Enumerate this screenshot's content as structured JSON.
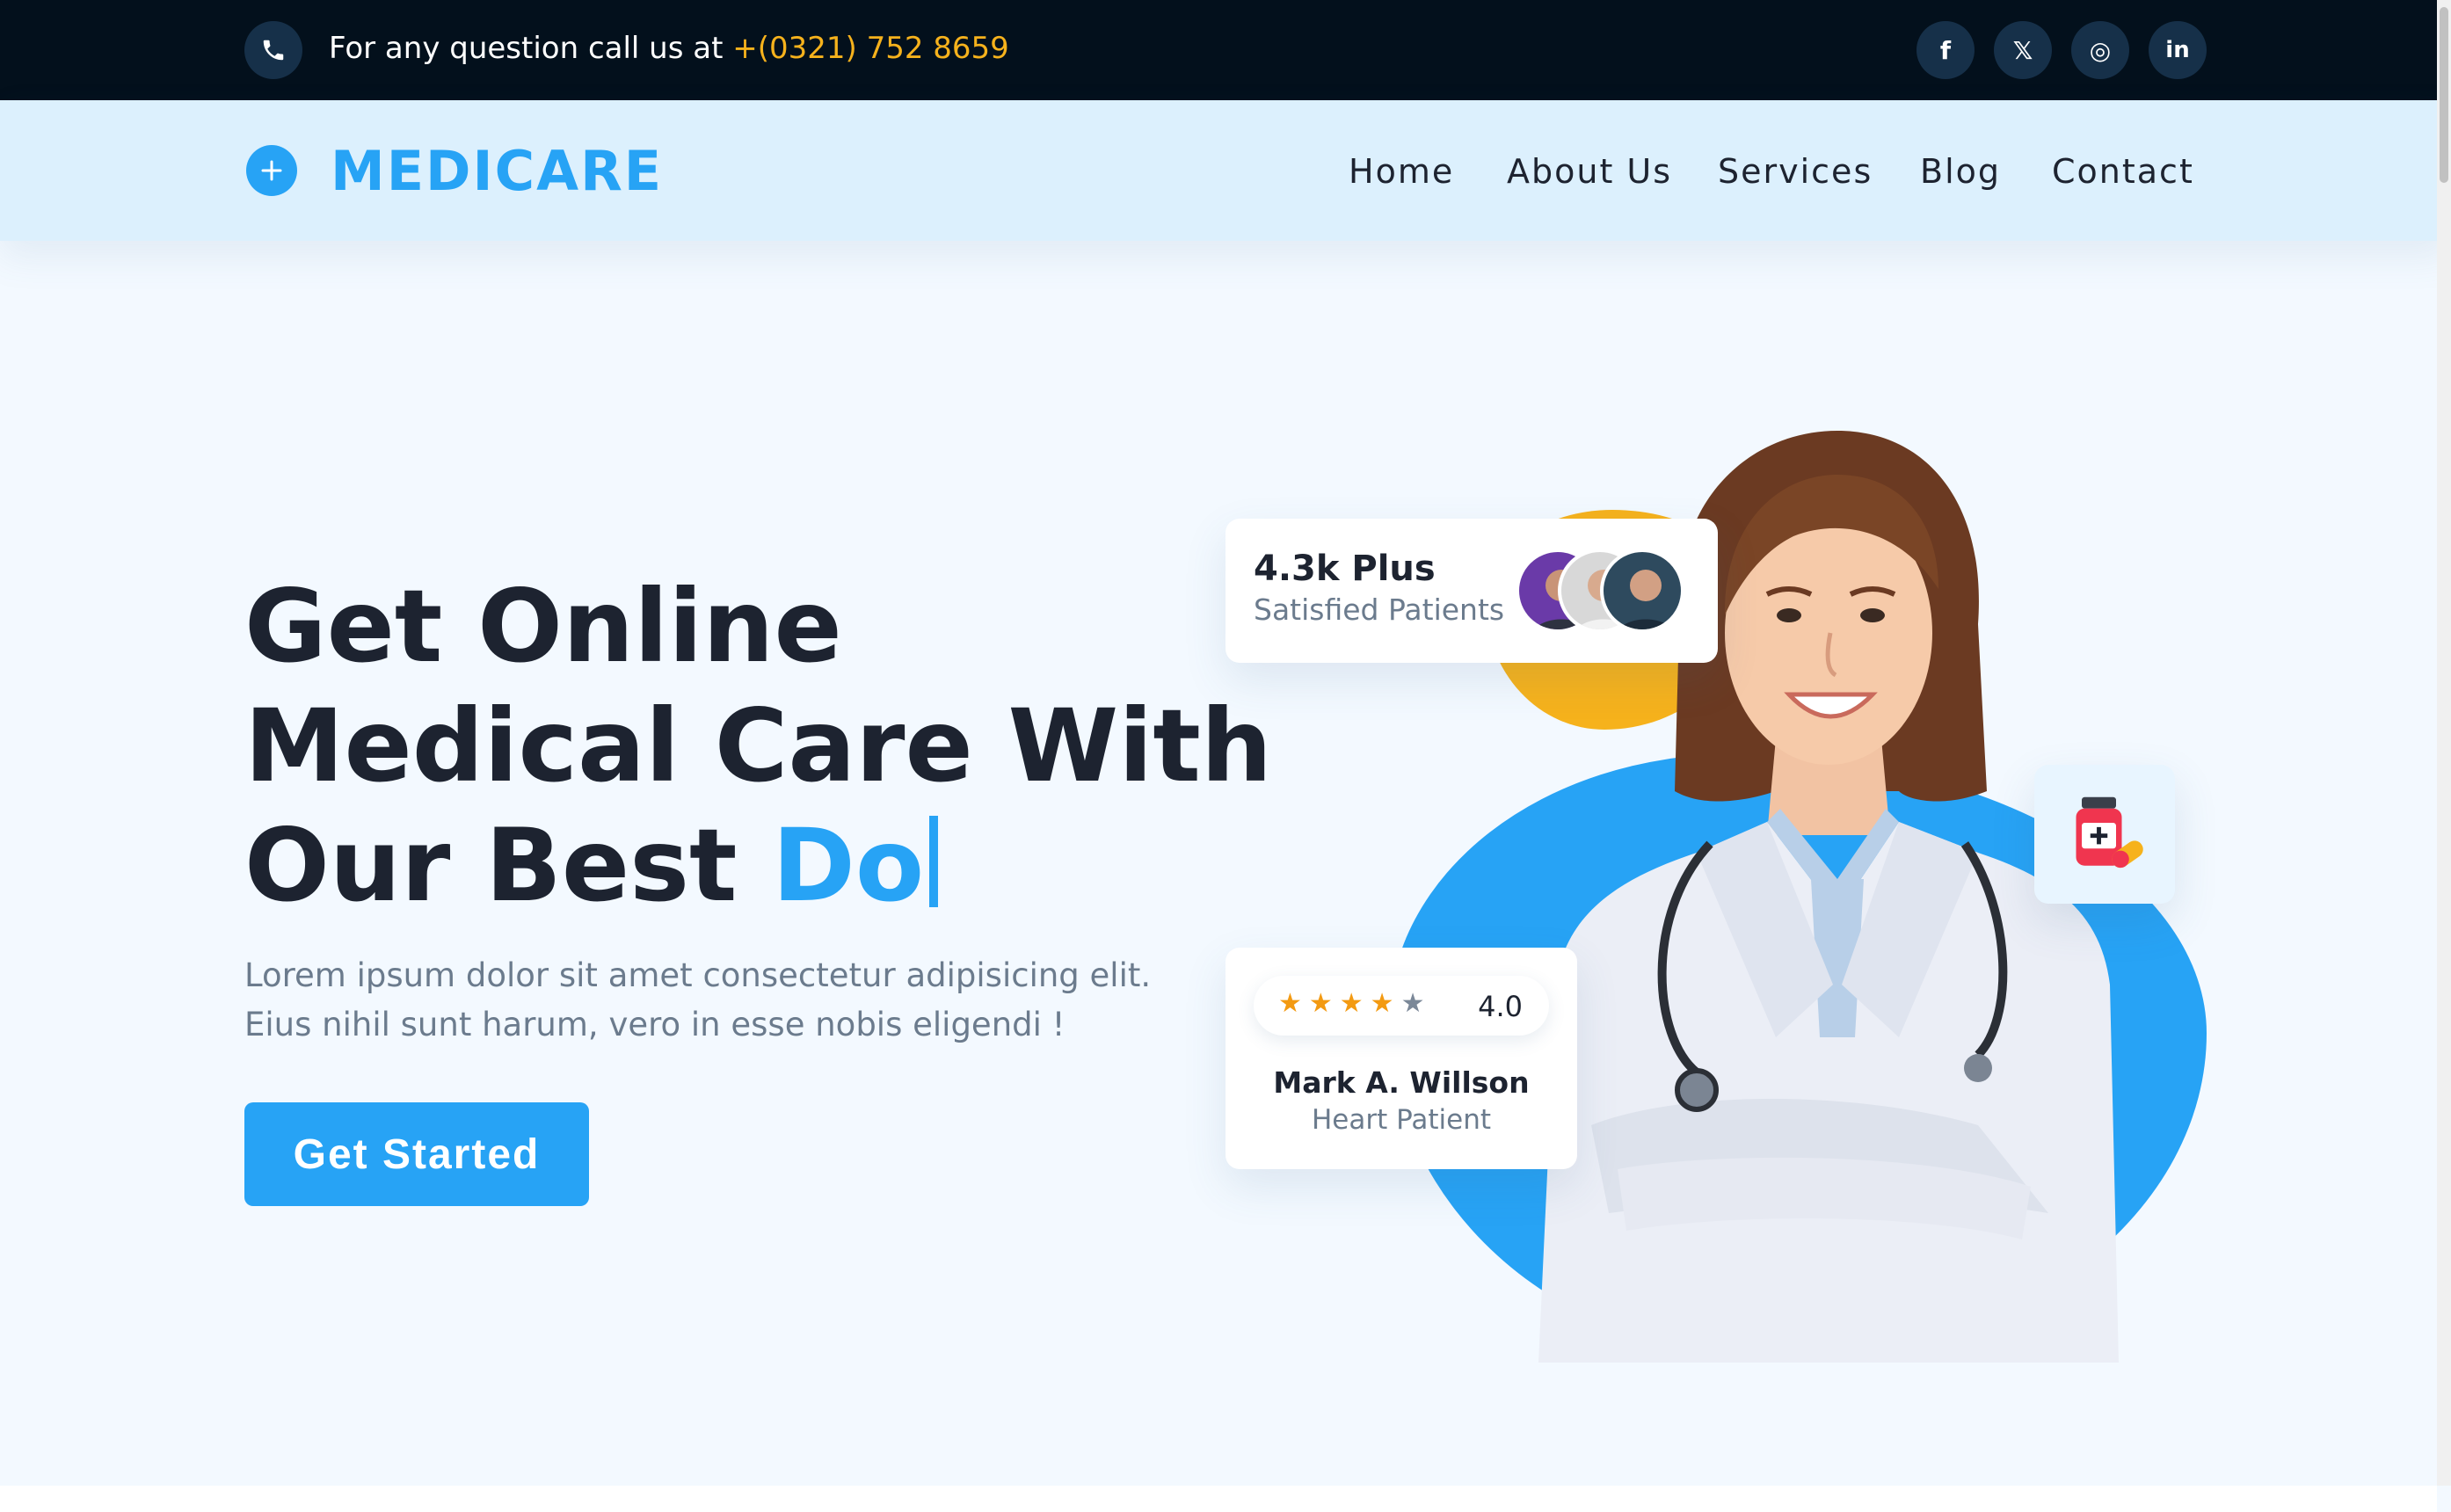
{
  "topbar": {
    "call_prefix": "For any question call us at ",
    "phone_number": "+(0321) 752 8659",
    "social": [
      {
        "icon": "facebook-icon",
        "glyph": "f"
      },
      {
        "icon": "x-icon",
        "glyph": "𝕏"
      },
      {
        "icon": "instagram-icon",
        "glyph": "◎"
      },
      {
        "icon": "linkedin-icon",
        "glyph": "in"
      }
    ]
  },
  "brand": {
    "name": "MEDICARE",
    "accent_color": "#27a3f5"
  },
  "nav": {
    "items": [
      "Home",
      "About Us",
      "Services",
      "Blog",
      "Contact"
    ]
  },
  "hero": {
    "title_line1": "Get Online",
    "title_line2": "Medical Care With",
    "title_line3": "Our Best ",
    "title_typed": "Do",
    "description": "Lorem ipsum dolor sit amet consectetur adipisicing elit. Eius nihil sunt harum, vero in esse nobis eligendi !",
    "cta_label": "Get Started"
  },
  "patients_card": {
    "count": "4.3k Plus",
    "label": "Satisfied Patients"
  },
  "review_card": {
    "stars_filled": 4,
    "stars_total": 5,
    "rating": "4.0",
    "name": "Mark A. Willson",
    "role": "Heart Patient"
  },
  "colors": {
    "topbar_bg": "#03101c",
    "nav_bg": "#dcf0fd",
    "primary": "#27a3f5",
    "phone_highlight": "#f6b21c",
    "blob_yellow": "#f6b21c",
    "blob_red": "#f5234f"
  }
}
